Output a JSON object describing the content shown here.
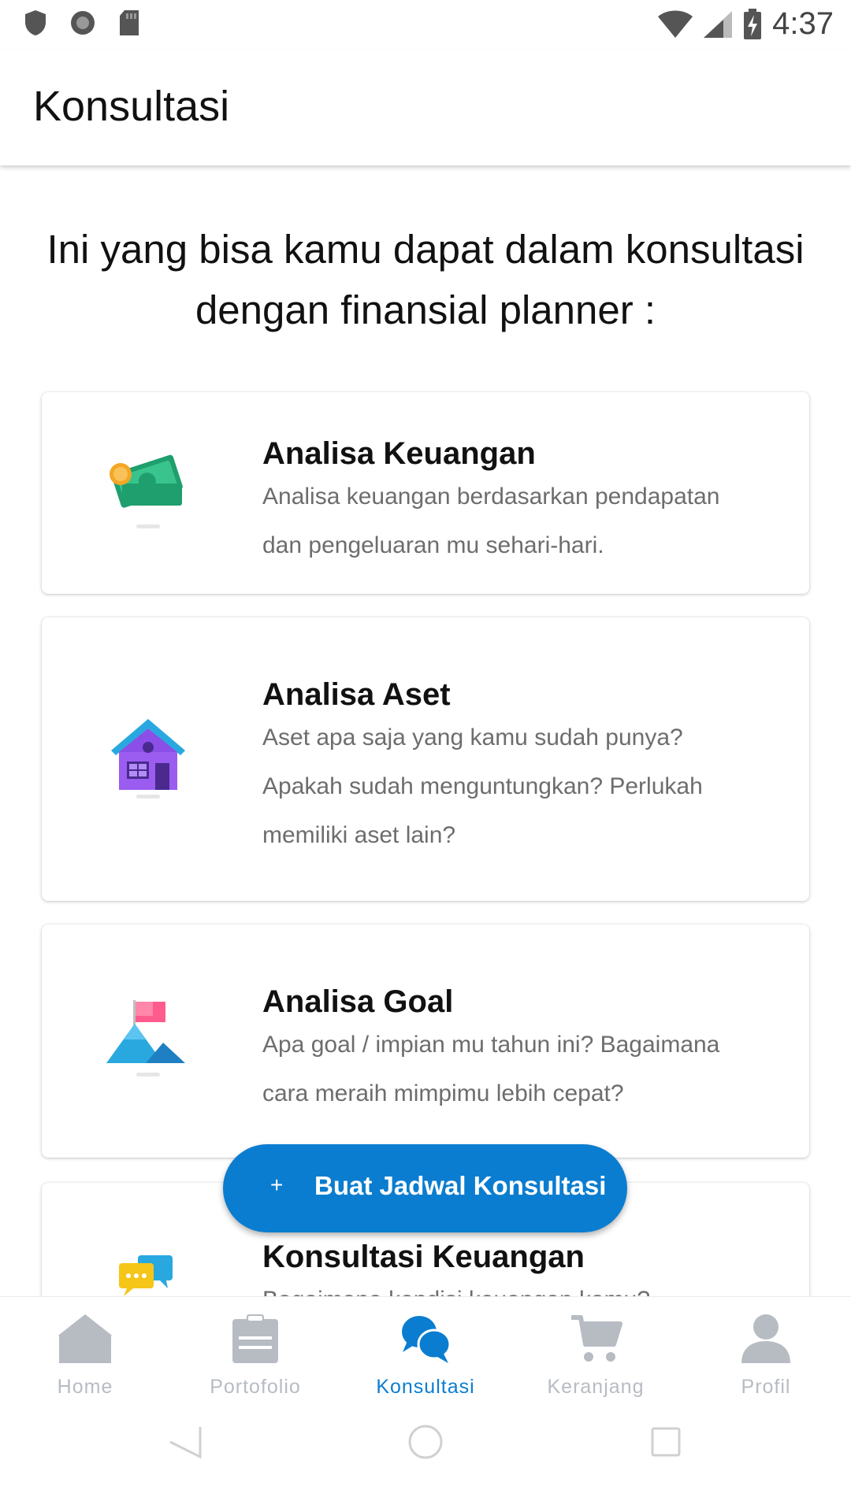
{
  "status_bar": {
    "time": "4:37",
    "icons": [
      "shield-icon",
      "record-icon",
      "sd-card-icon",
      "wifi-icon",
      "signal-icon",
      "battery-charging-icon"
    ]
  },
  "app_bar": {
    "title": "Konsultasi"
  },
  "intro": {
    "line1": "Ini yang bisa kamu dapat dalam konsultasi",
    "line2": "dengan finansial planner :"
  },
  "cards": [
    {
      "icon": "money-icon",
      "title": "Analisa Keuangan",
      "desc_lines": [
        "Analisa keuangan berdasarkan pendapatan",
        "dan pengeluaran mu sehari-hari."
      ]
    },
    {
      "icon": "house-icon",
      "title": "Analisa Aset",
      "desc_lines": [
        "Aset apa saja yang kamu sudah punya?",
        "Apakah sudah menguntungkan? Perlukah",
        "memiliki aset lain?"
      ]
    },
    {
      "icon": "mountain-flag-icon",
      "title": "Analisa Goal",
      "desc_lines": [
        "Apa goal / impian mu tahun ini? Bagaimana",
        "cara meraih mimpimu lebih cepat?"
      ]
    },
    {
      "icon": "chat-bubbles-icon",
      "title": "Konsultasi Keuangan",
      "desc_lines": [
        "Bagaimana kondisi keuangan kamu?"
      ]
    }
  ],
  "fab": {
    "plus": "+",
    "label": "Buat Jadwal Konsultasi"
  },
  "bottom_nav": {
    "items": [
      {
        "label": "Home",
        "icon": "home-icon",
        "active": false
      },
      {
        "label": "Portofolio",
        "icon": "clipboard-icon",
        "active": false
      },
      {
        "label": "Konsultasi",
        "icon": "chat-icon",
        "active": true
      },
      {
        "label": "Keranjang",
        "icon": "cart-icon",
        "active": false
      },
      {
        "label": "Profil",
        "icon": "person-icon",
        "active": false
      }
    ]
  },
  "colors": {
    "accent": "#0b7dd0",
    "inactive_nav": "#b7bcc3",
    "desc_text": "#6d6d6d"
  }
}
